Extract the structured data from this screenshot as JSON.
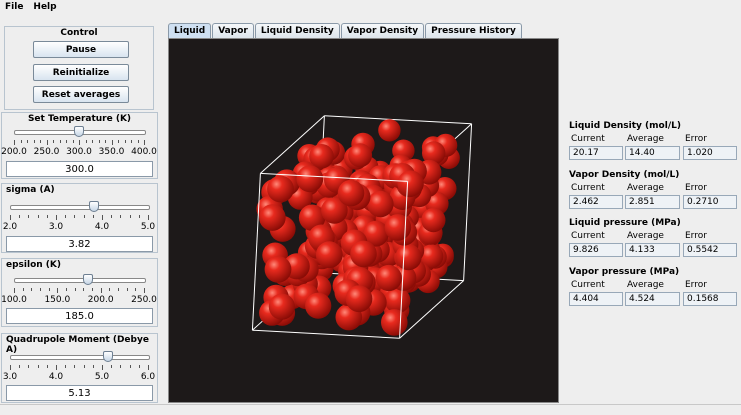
{
  "menu": {
    "file": "File",
    "help": "Help"
  },
  "control": {
    "title": "Control",
    "pause": "Pause",
    "reinitialize": "Reinitialize",
    "reset": "Reset averages"
  },
  "temperature": {
    "title": "Set Temperature (K)",
    "ticks": [
      "200.0",
      "250.0",
      "300.0",
      "350.0",
      "400.0"
    ],
    "value": "300.0",
    "min": 200,
    "max": 400,
    "current": 300
  },
  "sigma": {
    "title": "sigma (A)",
    "ticks": [
      "2.0",
      "3.0",
      "4.0",
      "5.0"
    ],
    "value": "3.82",
    "min": 2,
    "max": 5,
    "current": 3.82
  },
  "epsilon": {
    "title": "epsilon (K)",
    "ticks": [
      "100.0",
      "150.0",
      "200.0",
      "250.0"
    ],
    "value": "185.0",
    "min": 100,
    "max": 250,
    "current": 185
  },
  "quadrupole": {
    "title": "Quadrupole Moment (Debye A)",
    "ticks": [
      "3.0",
      "4.0",
      "5.0",
      "6.0"
    ],
    "value": "5.13",
    "min": 3,
    "max": 6,
    "current": 5.13
  },
  "tabs": [
    "Liquid",
    "Vapor",
    "Liquid Density",
    "Vapor Density",
    "Pressure History"
  ],
  "colors": {
    "molecule": "#d01818",
    "viewport_bg": "#1d1919",
    "box_edges": "#ffffff"
  },
  "stats": {
    "headers": {
      "current": "Current",
      "average": "Average",
      "error": "Error"
    },
    "liquid_density": {
      "title": "Liquid Density (mol/L)",
      "current": "20.17",
      "average": "14.40",
      "error": "1.020"
    },
    "vapor_density": {
      "title": "Vapor Density (mol/L)",
      "current": "2.462",
      "average": "2.851",
      "error": "0.2710"
    },
    "liquid_pressure": {
      "title": "Liquid pressure (MPa)",
      "current": "9.826",
      "average": "4.133",
      "error": "0.5542"
    },
    "vapor_pressure": {
      "title": "Vapor pressure (MPa)",
      "current": "4.404",
      "average": "4.524",
      "error": "0.1568"
    }
  }
}
